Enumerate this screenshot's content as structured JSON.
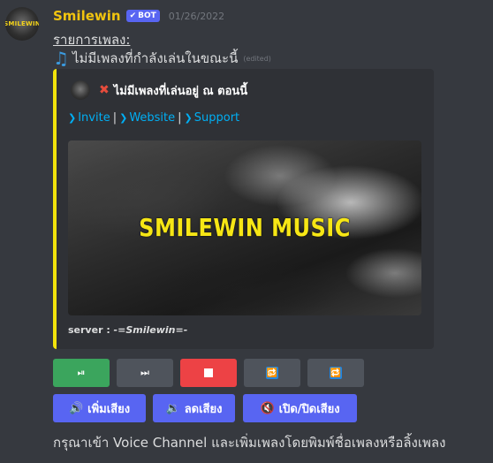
{
  "message": {
    "avatar_text": "SMILEWIN",
    "username": "Smilewin",
    "bot_tag": "BOT",
    "timestamp": "01/26/2022",
    "line1": "รายการเพลง:",
    "line2": "ไม่มีเพลงที่กำลังเล่นในขณะนี้",
    "edited": "(edited)",
    "note_icon": "musical-note-icon"
  },
  "embed": {
    "accent_color": "#f2e30b",
    "author": "ไม่มีเพลงที่เล่นอยู่ ณ ตอนนี้",
    "links": [
      {
        "label": "Invite"
      },
      {
        "label": "Website"
      },
      {
        "label": "Support"
      }
    ],
    "link_sep": "|",
    "image_title": "SMILEWIN MUSIC",
    "footer_prefix": "server : ",
    "footer_name": "-=Smilewin=-"
  },
  "buttons_row1": [
    {
      "name": "play-pause-button",
      "icon": "play-pause-icon",
      "color": "#3ba55d"
    },
    {
      "name": "skip-button",
      "icon": "skip-icon",
      "color": "#4f545c"
    },
    {
      "name": "stop-button",
      "icon": "stop-icon",
      "color": "#ed4245"
    },
    {
      "name": "repeat-one-button",
      "icon": "repeat-one-icon",
      "color": "#4f545c"
    },
    {
      "name": "repeat-button",
      "icon": "repeat-icon",
      "color": "#4f545c"
    }
  ],
  "buttons_row2": [
    {
      "label": "เพิ่มเสียง",
      "icon": "volume-up-icon"
    },
    {
      "label": "ลดเสียง",
      "icon": "volume-down-icon"
    },
    {
      "label": "เปิด/ปิดเสียง",
      "icon": "mute-icon"
    }
  ],
  "bottom_text": "กรุณาเข้า Voice Channel และเพิ่มเพลงโดยพิมพ์ชื่อเพลงหรือลิ้งเพลง",
  "colors": {
    "background": "#36393f",
    "blurple": "#5865f2",
    "username": "#f1c40f"
  }
}
